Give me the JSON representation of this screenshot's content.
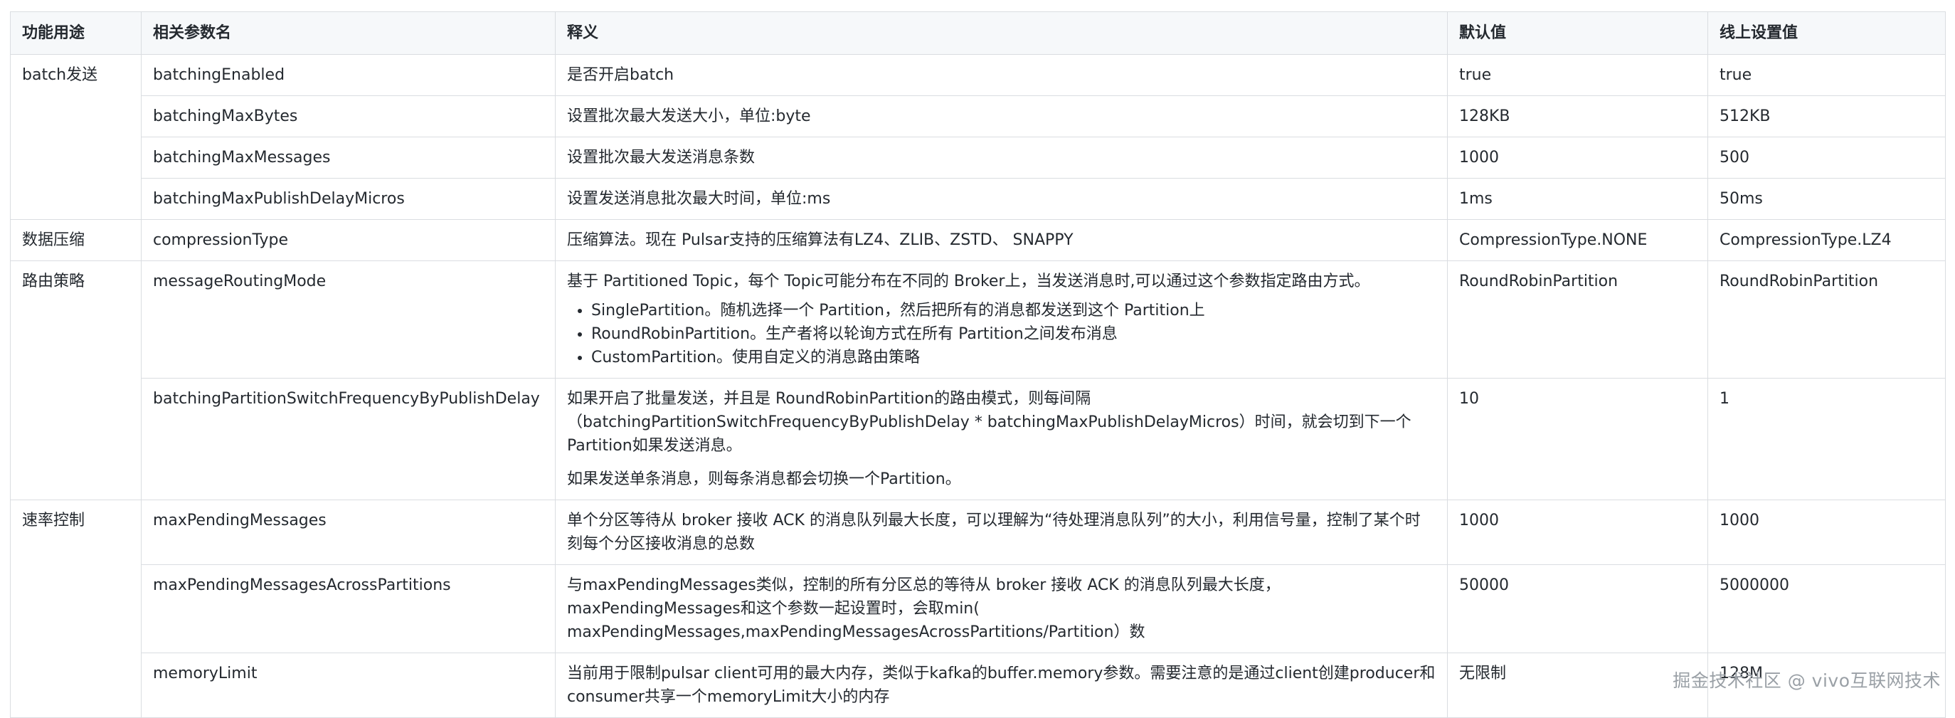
{
  "table": {
    "headers": [
      "功能用途",
      "相关参数名",
      "释义",
      "默认值",
      "线上设置值"
    ],
    "groups": {
      "batch": "batch发送",
      "compression": "数据压缩",
      "routing": "路由策略",
      "rate": "速率控制"
    },
    "rows": [
      {
        "param": "batchingEnabled",
        "desc": "是否开启batch",
        "default": "true",
        "online": "true"
      },
      {
        "param": "batchingMaxBytes",
        "desc": "设置批次最大发送大小，单位:byte",
        "default": "128KB",
        "online": "512KB"
      },
      {
        "param": "batchingMaxMessages",
        "desc": "设置批次最大发送消息条数",
        "default": "1000",
        "online": "500"
      },
      {
        "param": "batchingMaxPublishDelayMicros",
        "desc": "设置发送消息批次最大时间，单位:ms",
        "default": "1ms",
        "online": "50ms"
      },
      {
        "param": "compressionType",
        "desc": "压缩算法。现在 Pulsar支持的压缩算法有LZ4、ZLIB、ZSTD、 SNAPPY",
        "default": "CompressionType.NONE",
        "online": "CompressionType.LZ4"
      },
      {
        "param": "messageRoutingMode",
        "desc_intro": "基于 Partitioned Topic，每个 Topic可能分布在不同的 Broker上，当发送消息时,可以通过这个参数指定路由方式。",
        "desc_items": [
          "SinglePartition。随机选择一个 Partition，然后把所有的消息都发送到这个 Partition上",
          "RoundRobinPartition。生产者将以轮询方式在所有 Partition之间发布消息",
          "CustomPartition。使用自定义的消息路由策略"
        ],
        "default": "RoundRobinPartition",
        "online": "RoundRobinPartition"
      },
      {
        "param": "batchingPartitionSwitchFrequencyByPublishDelay",
        "desc_para1": "如果开启了批量发送，并且是 RoundRobinPartition的路由模式，则每间隔（batchingPartitionSwitchFrequencyByPublishDelay * batchingMaxPublishDelayMicros）时间，就会切到下一个Partition如果发送消息。",
        "desc_para2": "如果发送单条消息，则每条消息都会切换一个Partition。",
        "default": "10",
        "online": "1"
      },
      {
        "param": "maxPendingMessages",
        "desc": "单个分区等待从 broker 接收 ACK 的消息队列最大长度，可以理解为“待处理消息队列”的大小，利用信号量，控制了某个时刻每个分区接收消息的总数",
        "default": "1000",
        "online": "1000"
      },
      {
        "param": "maxPendingMessagesAcrossPartitions",
        "desc": "与maxPendingMessages类似，控制的所有分区总的等待从 broker 接收 ACK 的消息队列最大长度，maxPendingMessages和这个参数一起设置时，会取min( maxPendingMessages,maxPendingMessagesAcrossPartitions/Partition）数",
        "default": "50000",
        "online": "5000000"
      },
      {
        "param": "memoryLimit",
        "desc": "当前用于限制pulsar client可用的最大内存，类似于kafka的buffer.memory参数。需要注意的是通过client创建producer和consumer共享一个memoryLimit大小的内存",
        "default": "无限制",
        "online": "128M"
      }
    ]
  },
  "watermark": "掘金技术社区 @ vivo互联网技术"
}
